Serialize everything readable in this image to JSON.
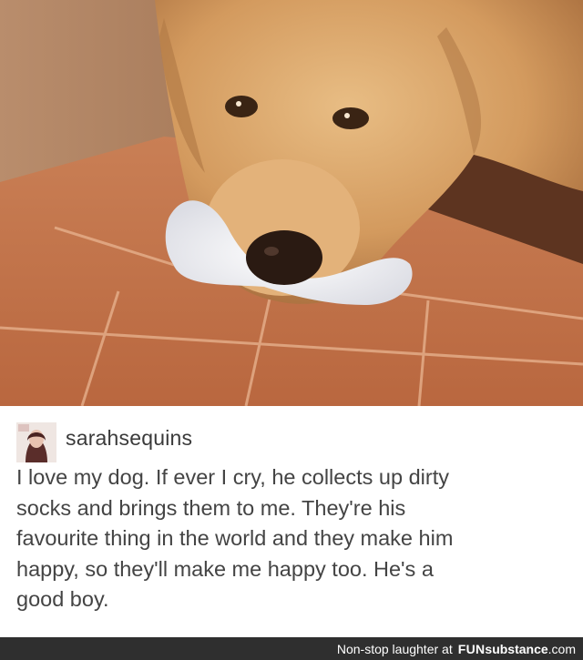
{
  "post": {
    "username": "sarahsequins",
    "text": "I love my dog. If ever I cry, he collects up dirty\nsocks and brings them to me. They're his\nfavourite thing in the world and they make him\nhappy, so they'll make me happy too. He's a\ngood boy."
  },
  "footer": {
    "tagline": "Non-stop laughter at",
    "brand_bold": "FUN",
    "brand_rest": "substance",
    "domain": ".com"
  },
  "colors": {
    "footer_bg": "#2f2f2f",
    "text": "#444444",
    "floor": "#c8744a",
    "fur": "#d9a56a"
  },
  "icons": {
    "avatar": "user-avatar-photo"
  }
}
